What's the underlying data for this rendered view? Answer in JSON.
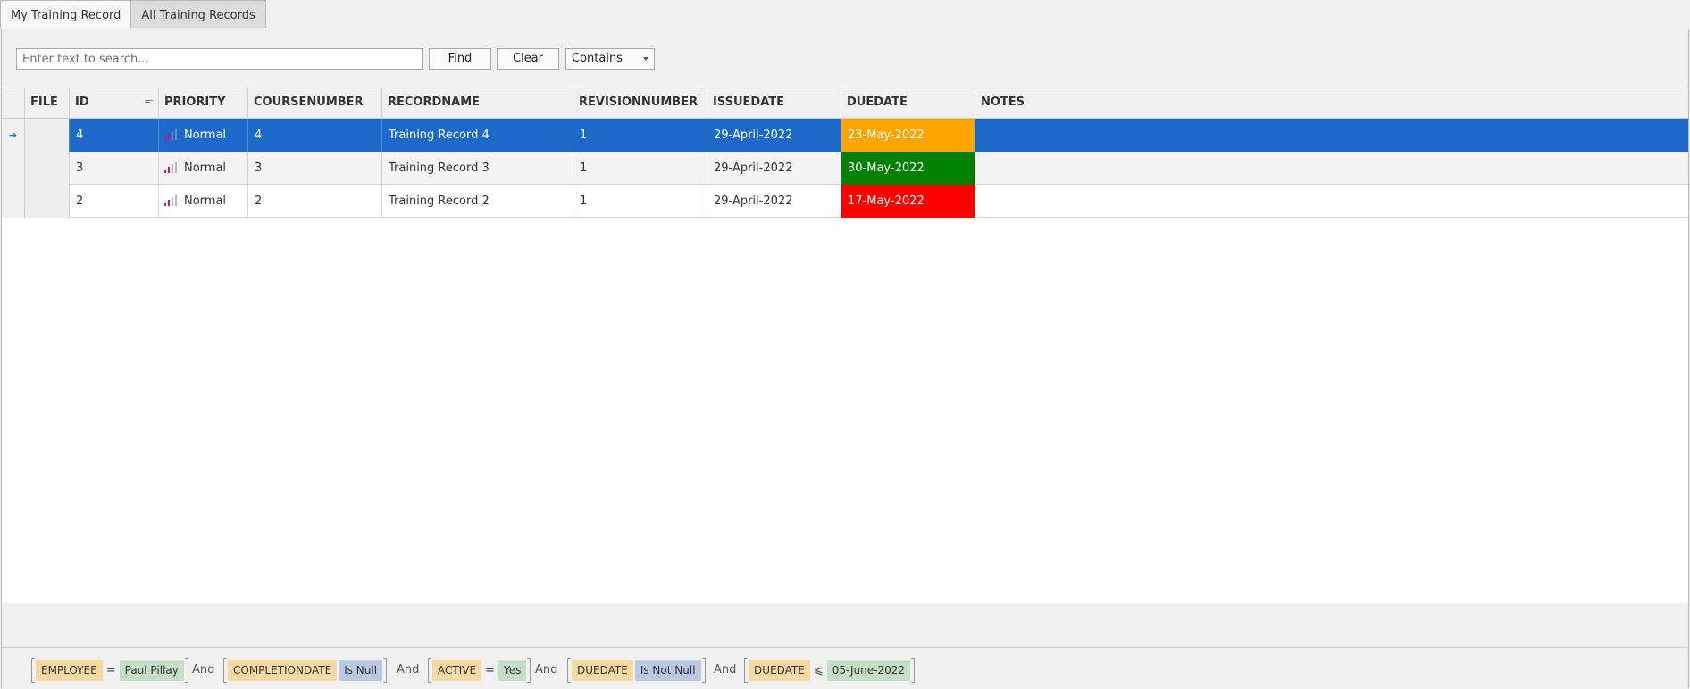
{
  "tabs": [
    {
      "label": "My Training Record"
    },
    {
      "label": "All Training Records"
    }
  ],
  "search": {
    "placeholder": "Enter text to search...",
    "value": "",
    "find_label": "Find",
    "clear_label": "Clear",
    "mode_selected": "Contains"
  },
  "grid": {
    "columns": [
      "FILE",
      "ID",
      "PRIORITY",
      "COURSENUMBER",
      "RECORDNAME",
      "REVISIONNUMBER",
      "ISSUEDATE",
      "DUEDATE",
      "NOTES"
    ],
    "rows": [
      {
        "id": "4",
        "priority": "Normal",
        "coursenumber": "4",
        "recordname": "Training Record 4",
        "revisionnumber": "1",
        "issuedate": "29-April-2022",
        "duedate": "23-May-2022",
        "notes": "",
        "duedate_color": "#ffa500",
        "selected": true
      },
      {
        "id": "3",
        "priority": "Normal",
        "coursenumber": "3",
        "recordname": "Training Record 3",
        "revisionnumber": "1",
        "issuedate": "29-April-2022",
        "duedate": "30-May-2022",
        "notes": "",
        "duedate_color": "#008000",
        "selected": false
      },
      {
        "id": "2",
        "priority": "Normal",
        "coursenumber": "2",
        "recordname": "Training Record 2",
        "revisionnumber": "1",
        "issuedate": "29-April-2022",
        "duedate": "17-May-2022",
        "notes": "",
        "duedate_color": "#ff0000",
        "selected": false
      }
    ]
  },
  "filter": {
    "conjunction": "And",
    "conditions": [
      {
        "field": "EMPLOYEE",
        "operator": "=",
        "value": "Paul Pillay"
      },
      {
        "field": "COMPLETIONDATE",
        "operator": "Is Null",
        "value": ""
      },
      {
        "field": "ACTIVE",
        "operator": "=",
        "value": "Yes"
      },
      {
        "field": "DUEDATE",
        "operator": "Is Not Null",
        "value": ""
      },
      {
        "field": "DUEDATE",
        "operator": "⩽",
        "value": "05-June-2022"
      }
    ]
  },
  "colors": {
    "selection": "#1c69c9",
    "due_orange": "#ffa500",
    "due_green": "#008000",
    "due_red": "#ff0000",
    "priority_icon": "#c0187a"
  }
}
